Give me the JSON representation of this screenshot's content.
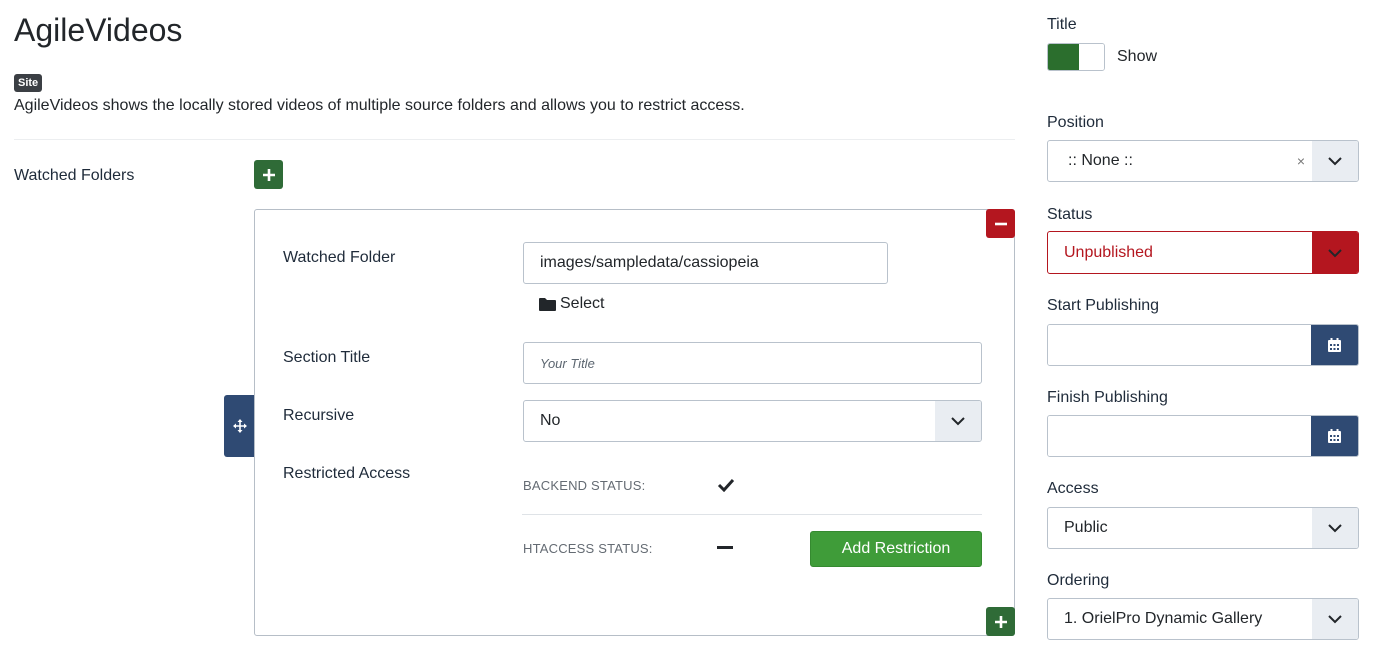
{
  "header": {
    "title": "AgileVideos",
    "badge": "Site",
    "description": "AgileVideos shows the locally stored videos of multiple source folders and allows you to restrict access."
  },
  "watched_folders": {
    "label": "Watched Folders",
    "item": {
      "folder_label": "Watched Folder",
      "folder_value": "images/sampledata/cassiopeia",
      "select_label": "Select",
      "section_title_label": "Section Title",
      "section_title_placeholder": "Your Title",
      "recursive_label": "Recursive",
      "recursive_value": "No",
      "restricted_label": "Restricted Access",
      "backend_status_label": "BACKEND STATUS:",
      "htaccess_status_label": "HTACCESS STATUS:",
      "add_restriction_label": "Add Restriction"
    }
  },
  "sidebar": {
    "title_label": "Title",
    "title_toggle_label": "Show",
    "position_label": "Position",
    "position_value": ":: None ::",
    "status_label": "Status",
    "status_value": "Unpublished",
    "start_label": "Start Publishing",
    "finish_label": "Finish Publishing",
    "access_label": "Access",
    "access_value": "Public",
    "ordering_label": "Ordering",
    "ordering_value": "1. OrielPro Dynamic Gallery"
  },
  "colors": {
    "primary_green": "#2f6b37",
    "danger_red": "#b4161f",
    "navy": "#2f4a73",
    "success_green": "#3f9c39"
  }
}
